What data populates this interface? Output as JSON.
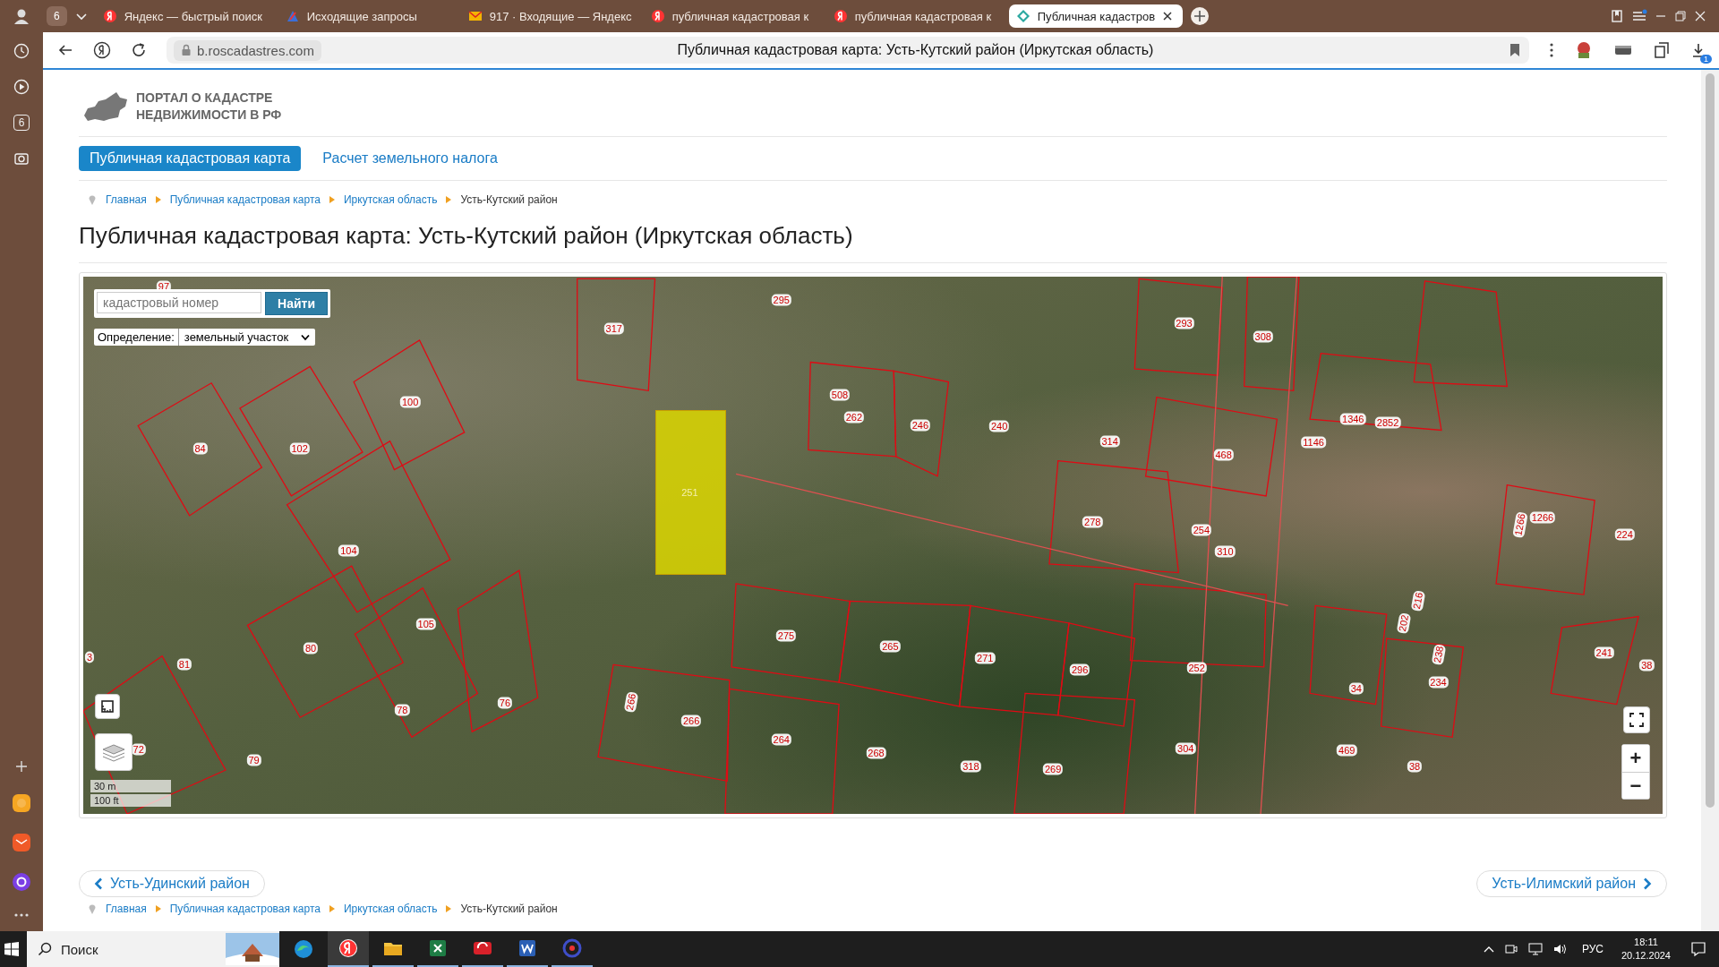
{
  "browser": {
    "tab_counter": "6",
    "tabs": [
      {
        "title": "Яндекс — быстрый поиск",
        "kind": "yandex",
        "selected": false
      },
      {
        "title": "Исходящие запросы",
        "kind": "site",
        "selected": false
      },
      {
        "title": "917 · Входящие — Яндекс",
        "kind": "mail",
        "selected": false
      },
      {
        "title": "публичная кадастровая к",
        "kind": "yandex",
        "selected": false
      },
      {
        "title": "публичная кадастровая к",
        "kind": "yandex",
        "selected": false
      },
      {
        "title": "Публичная кадастров",
        "kind": "cadastre",
        "selected": true
      }
    ],
    "address": "b.roscadastres.com",
    "page_title": "Публичная кадастровая карта: Усть-Кутский район (Иркутская область)",
    "download_badge": "1"
  },
  "sidebar": {
    "badge": "6"
  },
  "site": {
    "logo_lines": [
      "ПОРТАЛ О КАДАСТРЕ",
      "НЕДВИЖИМОСТИ В РФ"
    ],
    "nav": [
      {
        "label": "Публичная кадастровая карта",
        "selected": true
      },
      {
        "label": "Расчет земельного налога",
        "selected": false
      }
    ],
    "breadcrumbs": [
      {
        "label": "Главная",
        "link": true
      },
      {
        "label": "Публичная кадастровая карта",
        "link": true
      },
      {
        "label": "Иркутская область",
        "link": true
      },
      {
        "label": "Усть-Кутский район",
        "link": false
      }
    ],
    "heading": "Публичная кадастровая карта: Усть-Кутский район (Иркутская область)"
  },
  "map": {
    "search": {
      "placeholder": "кадастровый номер",
      "button": "Найти"
    },
    "filter": {
      "label": "Определение:",
      "value": "земельный участок"
    },
    "scale": [
      "30 m",
      "100 ft"
    ],
    "zoom_in": "+",
    "zoom_out": "−",
    "parcels": [
      {
        "number": "97",
        "vertical": false,
        "selected": false
      },
      {
        "number": "3",
        "vertical": false,
        "selected": false
      },
      {
        "number": "317",
        "vertical": false,
        "selected": false
      },
      {
        "number": "295",
        "vertical": false,
        "selected": false
      },
      {
        "number": "293",
        "vertical": false,
        "selected": false
      },
      {
        "number": "308",
        "vertical": false,
        "selected": false
      },
      {
        "number": "100",
        "vertical": false,
        "selected": false
      },
      {
        "number": "84",
        "vertical": false,
        "selected": false
      },
      {
        "number": "102",
        "vertical": false,
        "selected": false
      },
      {
        "number": "508",
        "vertical": false,
        "selected": false
      },
      {
        "number": "262",
        "vertical": false,
        "selected": false
      },
      {
        "number": "246",
        "vertical": false,
        "selected": false
      },
      {
        "number": "240",
        "vertical": false,
        "selected": false
      },
      {
        "number": "314",
        "vertical": false,
        "selected": false
      },
      {
        "number": "468",
        "vertical": false,
        "selected": false
      },
      {
        "number": "1146",
        "vertical": false,
        "selected": false
      },
      {
        "number": "1346",
        "vertical": false,
        "selected": false
      },
      {
        "number": "2852",
        "vertical": false,
        "selected": false
      },
      {
        "number": "251",
        "vertical": false,
        "selected": true
      },
      {
        "number": "278",
        "vertical": false,
        "selected": false
      },
      {
        "number": "254",
        "vertical": false,
        "selected": false
      },
      {
        "number": "310",
        "vertical": false,
        "selected": false
      },
      {
        "number": "1266",
        "vertical": false,
        "selected": false
      },
      {
        "number": "1266",
        "vertical": true,
        "selected": false
      },
      {
        "number": "224",
        "vertical": false,
        "selected": false
      },
      {
        "number": "104",
        "vertical": false,
        "selected": false
      },
      {
        "number": "105",
        "vertical": false,
        "selected": false
      },
      {
        "number": "80",
        "vertical": false,
        "selected": false
      },
      {
        "number": "81",
        "vertical": false,
        "selected": false
      },
      {
        "number": "275",
        "vertical": false,
        "selected": false
      },
      {
        "number": "265",
        "vertical": false,
        "selected": false
      },
      {
        "number": "271",
        "vertical": false,
        "selected": false
      },
      {
        "number": "296",
        "vertical": false,
        "selected": false
      },
      {
        "number": "252",
        "vertical": false,
        "selected": false
      },
      {
        "number": "216",
        "vertical": true,
        "selected": false
      },
      {
        "number": "202",
        "vertical": true,
        "selected": false
      },
      {
        "number": "241",
        "vertical": false,
        "selected": false
      },
      {
        "number": "38",
        "vertical": false,
        "selected": false
      },
      {
        "number": "238",
        "vertical": true,
        "selected": false
      },
      {
        "number": "234",
        "vertical": false,
        "selected": false
      },
      {
        "number": "34",
        "vertical": false,
        "selected": false
      },
      {
        "number": "78",
        "vertical": false,
        "selected": false
      },
      {
        "number": "76",
        "vertical": false,
        "selected": false
      },
      {
        "number": "266",
        "vertical": true,
        "selected": false
      },
      {
        "number": "266",
        "vertical": false,
        "selected": false
      },
      {
        "number": "264",
        "vertical": false,
        "selected": false
      },
      {
        "number": "268",
        "vertical": false,
        "selected": false
      },
      {
        "number": "318",
        "vertical": false,
        "selected": false
      },
      {
        "number": "269",
        "vertical": false,
        "selected": false
      },
      {
        "number": "304",
        "vertical": false,
        "selected": false
      },
      {
        "number": "469",
        "vertical": false,
        "selected": false
      },
      {
        "number": "38",
        "vertical": false,
        "selected": false
      },
      {
        "number": "72",
        "vertical": false,
        "selected": false
      },
      {
        "number": "79",
        "vertical": false,
        "selected": false
      }
    ]
  },
  "pager": {
    "prev": "Усть-Удинский район",
    "next": "Усть-Илимский район"
  },
  "footer_breadcrumbs": [
    {
      "label": "Главная",
      "link": true
    },
    {
      "label": "Публичная кадастровая карта",
      "link": true
    },
    {
      "label": "Иркутская область",
      "link": true
    },
    {
      "label": "Усть-Кутский район",
      "link": false
    }
  ],
  "taskbar": {
    "search": "Поиск",
    "language": "РУС",
    "time": "18:11",
    "date": "20.12.2024"
  }
}
